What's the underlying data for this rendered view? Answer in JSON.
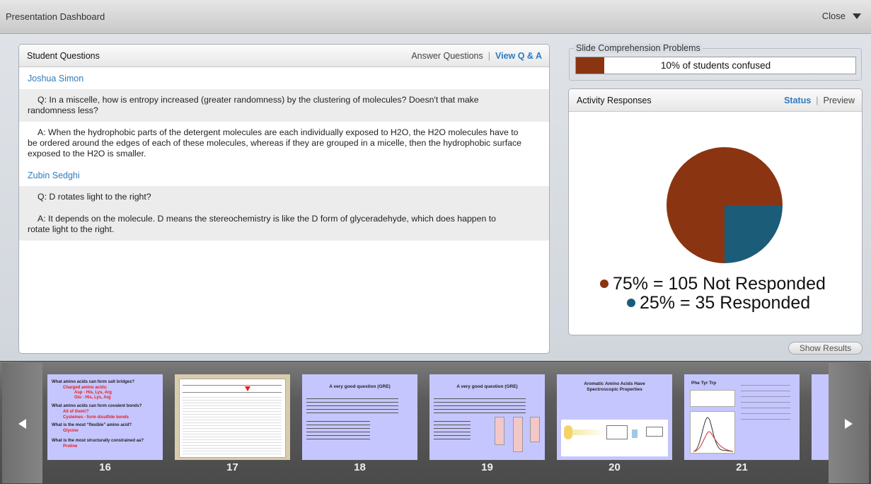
{
  "window": {
    "title": "Presentation Dashboard",
    "close_label": "Close"
  },
  "student_questions": {
    "title": "Student Questions",
    "answer_link": "Answer Questions",
    "separator": "|",
    "view_link": "View Q & A",
    "entries": [
      {
        "student": "Joshua Simon",
        "q_label": "Q:",
        "q_line1": "In a miscelle, how is entropy increased (greater randomness) by the clustering of molecules? Doesn't that make",
        "q_line2": "randomness less?",
        "a_label": "A:",
        "a_line1": "When the hydrophobic parts of the detergent molecules are each individually exposed to H2O, the H2O molecules have to",
        "a_line2": "be ordered around the edges of each of these molecules, whereas if they are grouped in a micelle, then the hydrophobic surface",
        "a_line3": "exposed to the H2O is smaller."
      },
      {
        "student": "Zubin Sedghi",
        "q_label": "Q:",
        "q_line1": "D rotates light to the right?",
        "a_label": "A:",
        "a_line1": "It depends on the molecule. D means the stereochemistry is like the D form of glyceradehyde, which does happen to",
        "a_line2": "rotate light to the right."
      }
    ]
  },
  "slide_comprehension": {
    "legend": "Slide Comprehension Problems",
    "percent_confused": 10,
    "text": "10% of students confused"
  },
  "activity_responses": {
    "title": "Activity Responses",
    "status_link": "Status",
    "separator": "|",
    "preview_link": "Preview",
    "legend_not_responded": "75% = 105 Not Responded",
    "legend_responded": "25% = 35 Responded"
  },
  "chart_data": {
    "type": "pie",
    "labels": [
      "Not Responded",
      "Responded"
    ],
    "values": [
      75,
      25
    ],
    "counts": [
      105,
      35
    ],
    "colors": [
      "#8b3411",
      "#1b5c78"
    ],
    "legend_placement": "bottom"
  },
  "show_results_label": "Show Results",
  "colors": {
    "link": "#2e7bbf",
    "confused_fill": "#8b3411",
    "slide_bg": "#c6c6ff"
  },
  "slides": [
    {
      "number": "16",
      "lines": [
        {
          "text": "What amino acids can form salt bridges?",
          "color": "blk"
        },
        {
          "text": "Charged amino acids:",
          "color": "red",
          "indent": true
        },
        {
          "text": "Asp - His, Lys, Arg",
          "color": "red",
          "indent2": true
        },
        {
          "text": "Glu - His, Lys, Arg",
          "color": "red",
          "indent2": true
        },
        {
          "text": "What amino acids can form covalent bonds?",
          "color": "blk"
        },
        {
          "text": "All of them!?",
          "color": "red",
          "indent": true
        },
        {
          "text": "Cysteines - form disulfide bonds",
          "color": "red",
          "indent": true
        },
        {
          "text": "What is the most “flexible” amino acid?",
          "color": "blk"
        },
        {
          "text": "Glycine",
          "color": "red",
          "indent": true
        },
        {
          "text": "What is the most structurally constrained aa?",
          "color": "blk"
        },
        {
          "text": "Proline",
          "color": "red",
          "indent": true
        }
      ]
    },
    {
      "number": "17"
    },
    {
      "number": "18",
      "title": "A very good question   (GRE)"
    },
    {
      "number": "19",
      "title": "A very good question   (GRE)"
    },
    {
      "number": "20",
      "title": "Aromatic Amino Acids Have Spectroscopic Properties"
    },
    {
      "number": "21",
      "title": "Phe   Tyr   Trp"
    }
  ]
}
